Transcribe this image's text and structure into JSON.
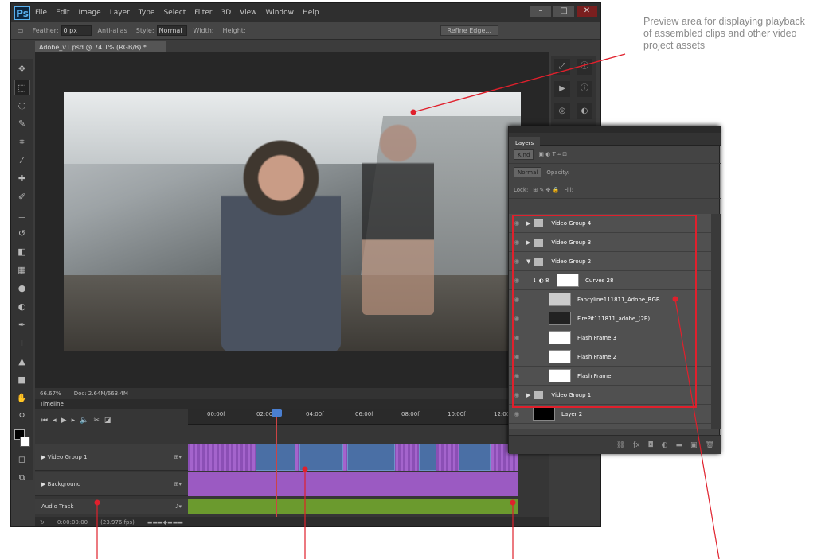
{
  "app": {
    "logo": "Ps",
    "menu": [
      "File",
      "Edit",
      "Image",
      "Layer",
      "Type",
      "Select",
      "Filter",
      "3D",
      "View",
      "Window",
      "Help"
    ],
    "window_controls": [
      "–",
      "□",
      "✕"
    ]
  },
  "options_bar": {
    "feather_label": "Feather:",
    "feather_value": "0 px",
    "antialias_label": "Anti-alias",
    "style_label": "Style:",
    "style_value": "Normal",
    "width_label": "Width:",
    "height_label": "Height:",
    "refine_button": "Refine Edge..."
  },
  "document": {
    "tab_title": "Adobe_v1.psd @ 74.1% (RGB/8) *",
    "zoom": "66.67%",
    "doc_size": "Doc: 2.64M/663.4M"
  },
  "timeline": {
    "tab": "Timeline",
    "ticks": [
      "00:00f",
      "02:00f",
      "04:00f",
      "06:00f",
      "08:00f",
      "10:00f",
      "12:00f"
    ],
    "tracks": [
      "Video Group 1",
      "Background",
      "Audio Track"
    ],
    "footer_time": "0:00:00:00",
    "footer_fps": "(23.976 fps)"
  },
  "layers_panel": {
    "tab": "Layers",
    "filter": "Kind",
    "blend_mode": "Normal",
    "opacity_label": "Opacity:",
    "lock_label": "Lock:",
    "fill_label": "Fill:",
    "layers": [
      {
        "name": "Video Group 4",
        "type": "group"
      },
      {
        "name": "Video Group 3",
        "type": "group"
      },
      {
        "name": "Video Group 2",
        "type": "group-open"
      },
      {
        "name": "Curves 28",
        "type": "adjust"
      },
      {
        "name": "Fancyline111811_Adobe_RGB...",
        "type": "video"
      },
      {
        "name": "FirePit111811_adobe_(2E)",
        "type": "video"
      },
      {
        "name": "Flash Frame 3",
        "type": "layer"
      },
      {
        "name": "Flash Frame 2",
        "type": "layer"
      },
      {
        "name": "Flash Frame",
        "type": "layer"
      },
      {
        "name": "Video Group 1",
        "type": "group"
      },
      {
        "name": "Layer 2",
        "type": "layer"
      }
    ]
  },
  "callout": {
    "text": "Preview area for displaying playback of assembled clips and other video project assets",
    "color": "#8a8a8a",
    "line_color": "#e0202c"
  }
}
